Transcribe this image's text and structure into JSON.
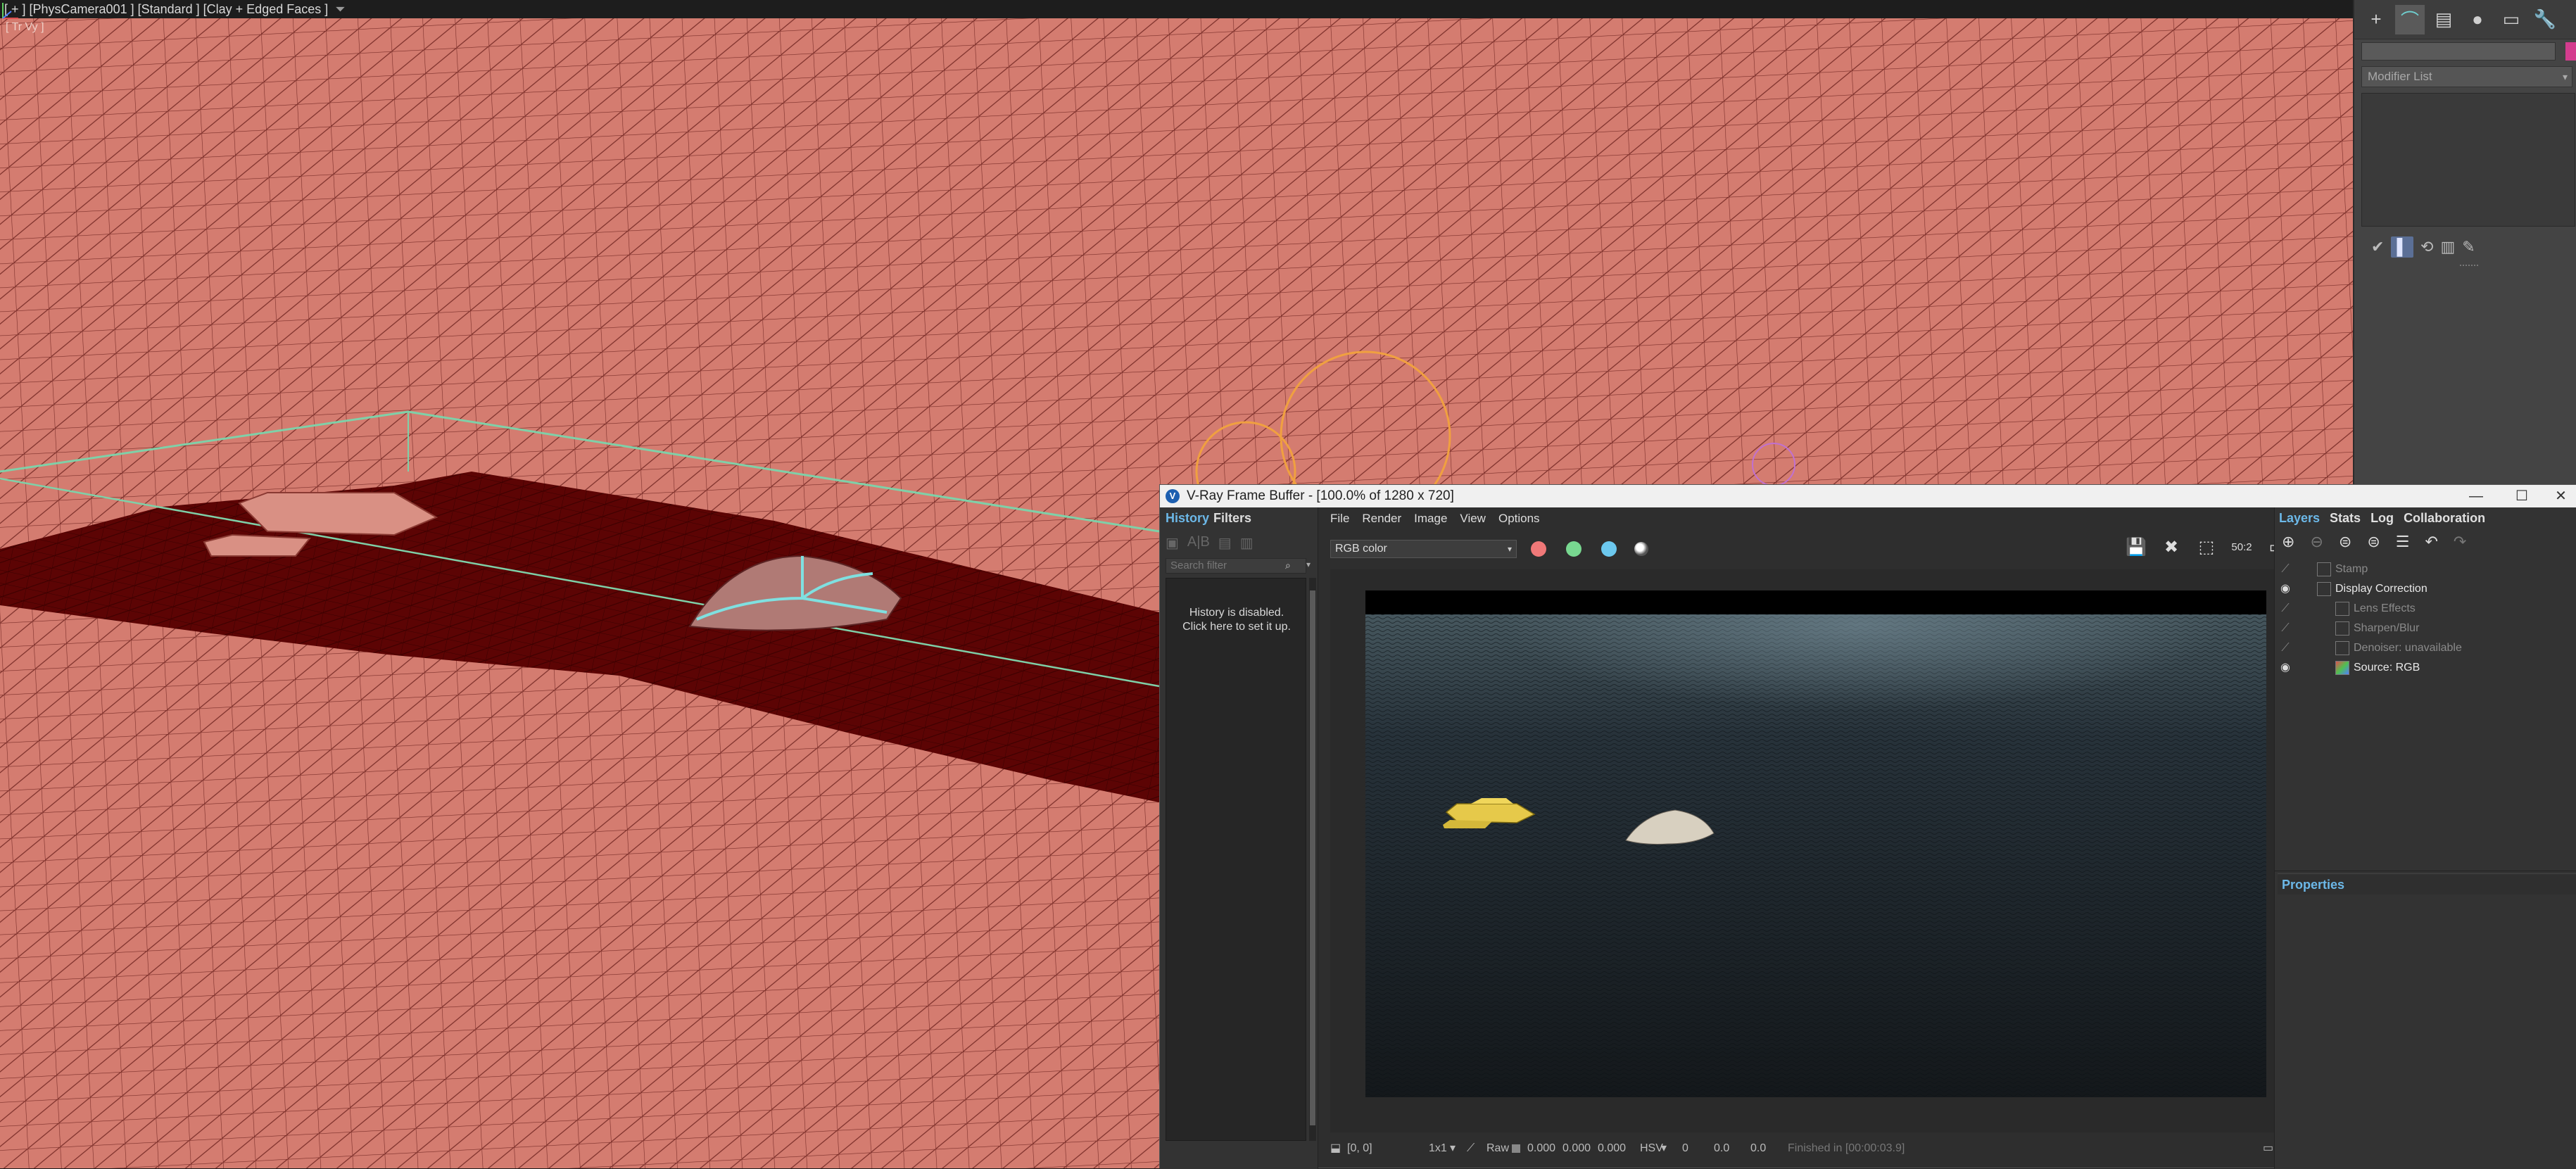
{
  "viewport": {
    "label": "[ + ] [PhysCamera001 ] [Standard ] [Clay + Edged Faces ]",
    "sub_label": "[ Tr Vy ]"
  },
  "command_panel": {
    "modifier_list_label": "Modifier List",
    "swatch_color": "#d43c8e"
  },
  "vfb": {
    "title": "V-Ray Frame Buffer - [100.0% of 1280 x 720]",
    "history_tabs": [
      "History",
      "Filters"
    ],
    "search_placeholder": "Search filter",
    "history_message": [
      "History is disabled.",
      "Click here to set it up."
    ],
    "menu": [
      "File",
      "Render",
      "Image",
      "View",
      "Options"
    ],
    "channel": "RGB color",
    "layers_tabs": [
      "Layers",
      "Stats",
      "Log",
      "Collaboration"
    ],
    "layers": [
      {
        "label": "Stamp",
        "visible": false,
        "indent": 1
      },
      {
        "label": "Display Correction",
        "visible": true,
        "indent": 1
      },
      {
        "label": "Lens Effects",
        "visible": false,
        "indent": 2
      },
      {
        "label": "Sharpen/Blur",
        "visible": false,
        "indent": 2
      },
      {
        "label": "Denoiser: unavailable",
        "visible": false,
        "indent": 2
      },
      {
        "label": "Source: RGB",
        "visible": true,
        "indent": 2
      }
    ],
    "properties_label": "Properties",
    "status": {
      "coords": "[0, 0]",
      "zoom": "1x1",
      "raw_label": "Raw",
      "raw_values": [
        "0.000",
        "0.000",
        "0.000"
      ],
      "color_mode": "HSV",
      "hsv_values": [
        "0",
        "0.0",
        "0.0"
      ],
      "finished": "Finished in [00:00:03.9]"
    },
    "toolbar_zoom_value": "50:2"
  }
}
